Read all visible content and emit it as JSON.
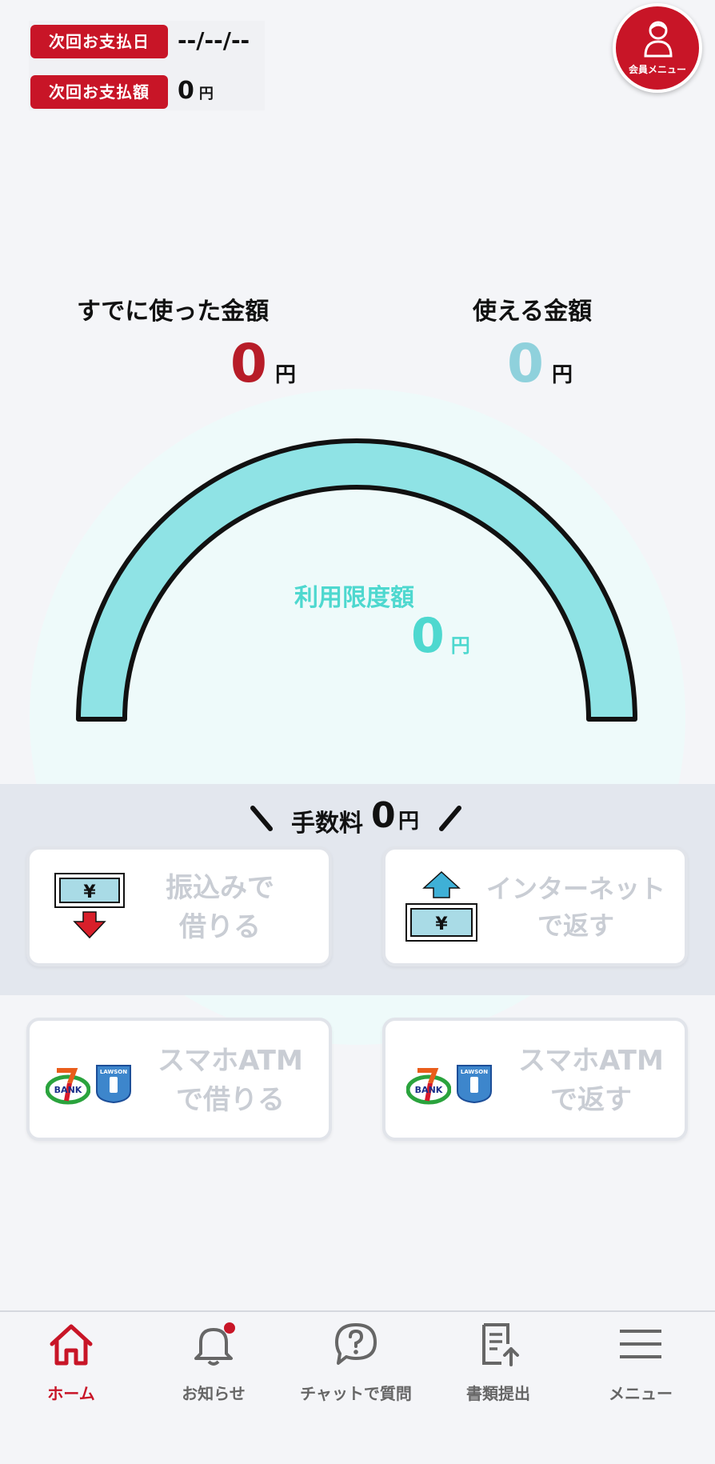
{
  "header": {
    "next_payment_date_label": "次回お支払日",
    "next_payment_date_value": "--/--/--",
    "next_payment_amount_label": "次回お支払額",
    "next_payment_amount_value": "0",
    "next_payment_amount_unit": "円",
    "member_menu_label": "会員メニュー"
  },
  "summary": {
    "used_label": "すでに使った金額",
    "used_value": "0",
    "used_unit": "円",
    "available_label": "使える金額",
    "available_value": "0",
    "available_unit": "円"
  },
  "gauge": {
    "limit_label": "利用限度額",
    "limit_value": "0",
    "limit_unit": "円",
    "used_fraction": 0
  },
  "fee": {
    "prefix": "手数料",
    "value": "0",
    "unit": "円"
  },
  "actions": {
    "transfer_borrow_line1": "振込みで",
    "transfer_borrow_line2": "借りる",
    "internet_repay_line1": "インターネット",
    "internet_repay_line2": "で返す",
    "atm_borrow_line1": "スマホATM",
    "atm_borrow_line2": "で借りる",
    "atm_repay_line1": "スマホATM",
    "atm_repay_line2": "で返す",
    "bank_logo_text": "BANK",
    "lawson_logo_text": "LAWSON STATION"
  },
  "nav": {
    "home": "ホーム",
    "notifications": "お知らせ",
    "chat": "チャットで質問",
    "documents": "書類提出",
    "menu": "メニュー"
  },
  "colors": {
    "brand_red": "#c81527",
    "gauge_cyan": "#8fe3e5",
    "limit_text": "#4ed8cf",
    "available_text": "#8fd1dc"
  }
}
